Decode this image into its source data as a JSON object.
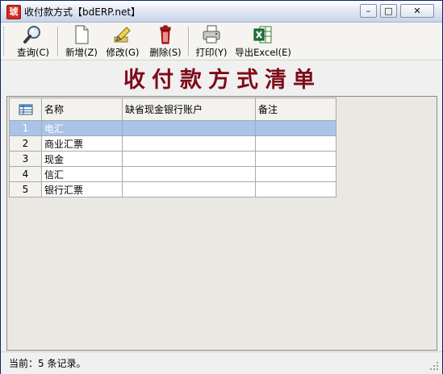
{
  "window": {
    "title": "收付款方式【bdERP.net】",
    "icon_char": "琥",
    "minimize_glyph": "–",
    "maximize_glyph": "□",
    "close_glyph": "✕"
  },
  "toolbar": {
    "query_label": "查询(C)",
    "new_label": "新增(Z)",
    "edit_label": "修改(G)",
    "delete_label": "删除(S)",
    "print_label": "打印(Y)",
    "export_label": "导出Excel(E)"
  },
  "report": {
    "title": "收付款方式清单"
  },
  "grid": {
    "columns": [
      "名称",
      "缺省现金银行账户",
      "备注"
    ],
    "rows": [
      {
        "num": "1",
        "name": "电汇",
        "account": "",
        "note": ""
      },
      {
        "num": "2",
        "name": "商业汇票",
        "account": "",
        "note": ""
      },
      {
        "num": "3",
        "name": "现金",
        "account": "",
        "note": ""
      },
      {
        "num": "4",
        "name": "信汇",
        "account": "",
        "note": ""
      },
      {
        "num": "5",
        "name": "银行汇票",
        "account": "",
        "note": ""
      }
    ],
    "selected_row": 0
  },
  "status": {
    "text": "当前：5 条记录。"
  },
  "colors": {
    "title_red": "#7d0b1a",
    "selection_blue": "#a9c4e8"
  }
}
